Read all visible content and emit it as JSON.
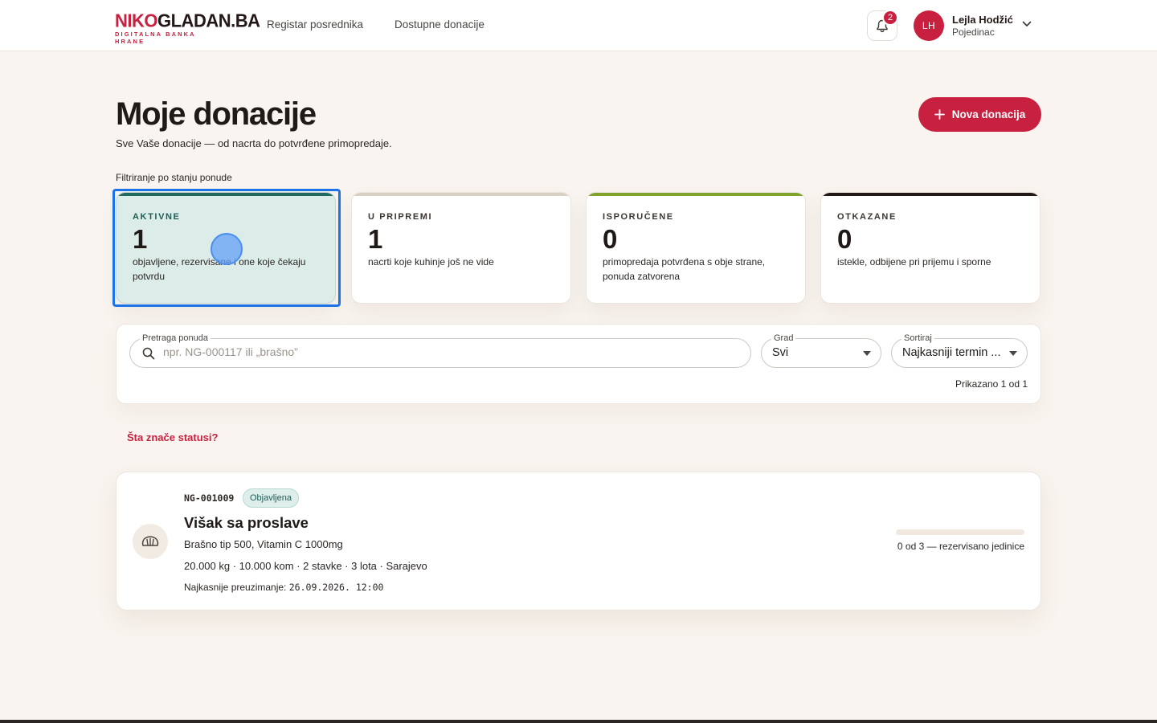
{
  "header": {
    "logo": {
      "part1": "NIKO",
      "part2": "GLADAN.BA",
      "tagline": "DIGITALNA BANKA HRANE"
    },
    "nav": [
      {
        "label": "Registar posrednika"
      },
      {
        "label": "Dostupne donacije"
      }
    ],
    "notifications": {
      "icon": "bell-icon",
      "count": "2"
    },
    "user": {
      "initials": "LH",
      "name": "Lejla Hodžić",
      "role": "Pojedinac",
      "menu_icon": "chevron-down-icon"
    }
  },
  "page": {
    "title": "Moje donacije",
    "subtitle": "Sve Vaše donacije — od nacrta do potvrđene primopredaje.",
    "new_button": {
      "label": "Nova donacija",
      "icon": "plus-icon"
    },
    "filter_label": "Filtriranje po stanju ponude"
  },
  "status_cards": [
    {
      "label": "AKTIVNE",
      "count": "1",
      "desc": "objavljene, rezervisane i one koje čekaju potvrdu",
      "accent": "#1f6b60",
      "selected": true
    },
    {
      "label": "U PRIPREMI",
      "count": "1",
      "desc": "nacrti koje kuhinje još ne vide",
      "accent": "#d9cfc3",
      "selected": false
    },
    {
      "label": "ISPORUČENE",
      "count": "0",
      "desc": "primopredaja potvrđena s obje strane, ponuda zatvorena",
      "accent": "#7fa32a",
      "selected": false
    },
    {
      "label": "OTKAZANE",
      "count": "0",
      "desc": "istekle, odbijene pri prijemu i sporne",
      "accent": "#231815",
      "selected": false
    }
  ],
  "search": {
    "legend": "Pretraga ponuda",
    "placeholder": "npr. NG-000117 ili „brašno”",
    "value": "",
    "city": {
      "legend": "Grad",
      "value": "Svi"
    },
    "sort": {
      "legend": "Sortiraj",
      "value": "Najkasniji termin ..."
    },
    "shown": "Prikazano 1 od 1"
  },
  "help_link": "Šta znače statusi?",
  "donations": [
    {
      "id": "NG-001009",
      "status": "Objavljena",
      "title": "Višak sa proslave",
      "items": "Brašno tip 500, Vitamin C 1000mg",
      "meta": "20.000 kg · 10.000 kom · 2 stavke · 3 lota · Sarajevo",
      "deadline_label": "Najkasnije preuzimanje:",
      "deadline_value": "26.09.2026. 12:00",
      "reserved_fraction": 0,
      "reserved_text": "0 od 3 — rezervisano jedinice",
      "icon": "bread-icon"
    }
  ],
  "colors": {
    "brand": "#c8203f",
    "background": "#f9f4ef",
    "selected_card": "#dcece9",
    "focus_outline": "#1a73e8"
  }
}
